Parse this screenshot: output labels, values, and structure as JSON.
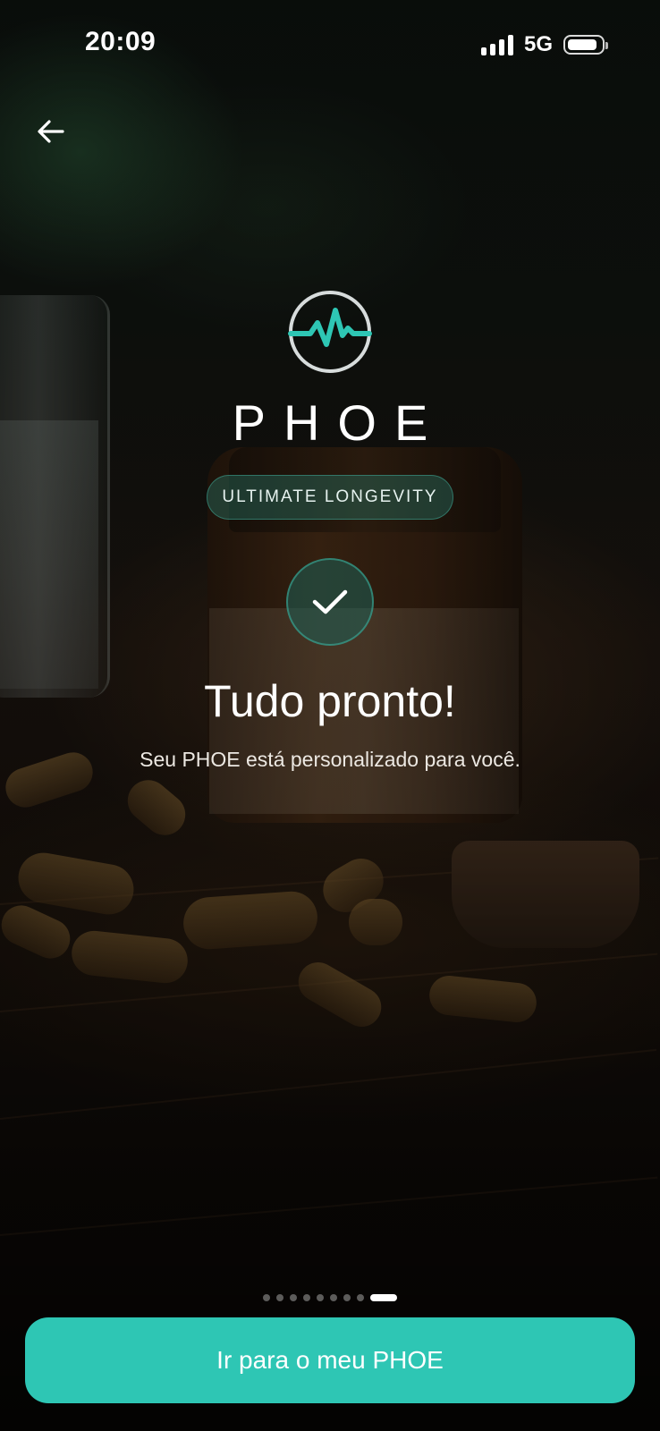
{
  "status_bar": {
    "time": "20:09",
    "network": "5G",
    "signal_bars": 4,
    "battery_level": 0.9
  },
  "header": {
    "back_icon": "arrow-left-icon"
  },
  "brand": {
    "logo_icon": "heartbeat-circle-icon",
    "name": "PHOE",
    "tagline": "ULTIMATE LONGEVITY",
    "accent_color": "#2ec6b4"
  },
  "success": {
    "icon": "checkmark-icon",
    "title": "Tudo pronto!",
    "subtitle": "Seu PHOE está personalizado para você."
  },
  "pager": {
    "total_pages": 9,
    "current_page": 9
  },
  "cta": {
    "label": "Ir para o meu PHOE"
  }
}
